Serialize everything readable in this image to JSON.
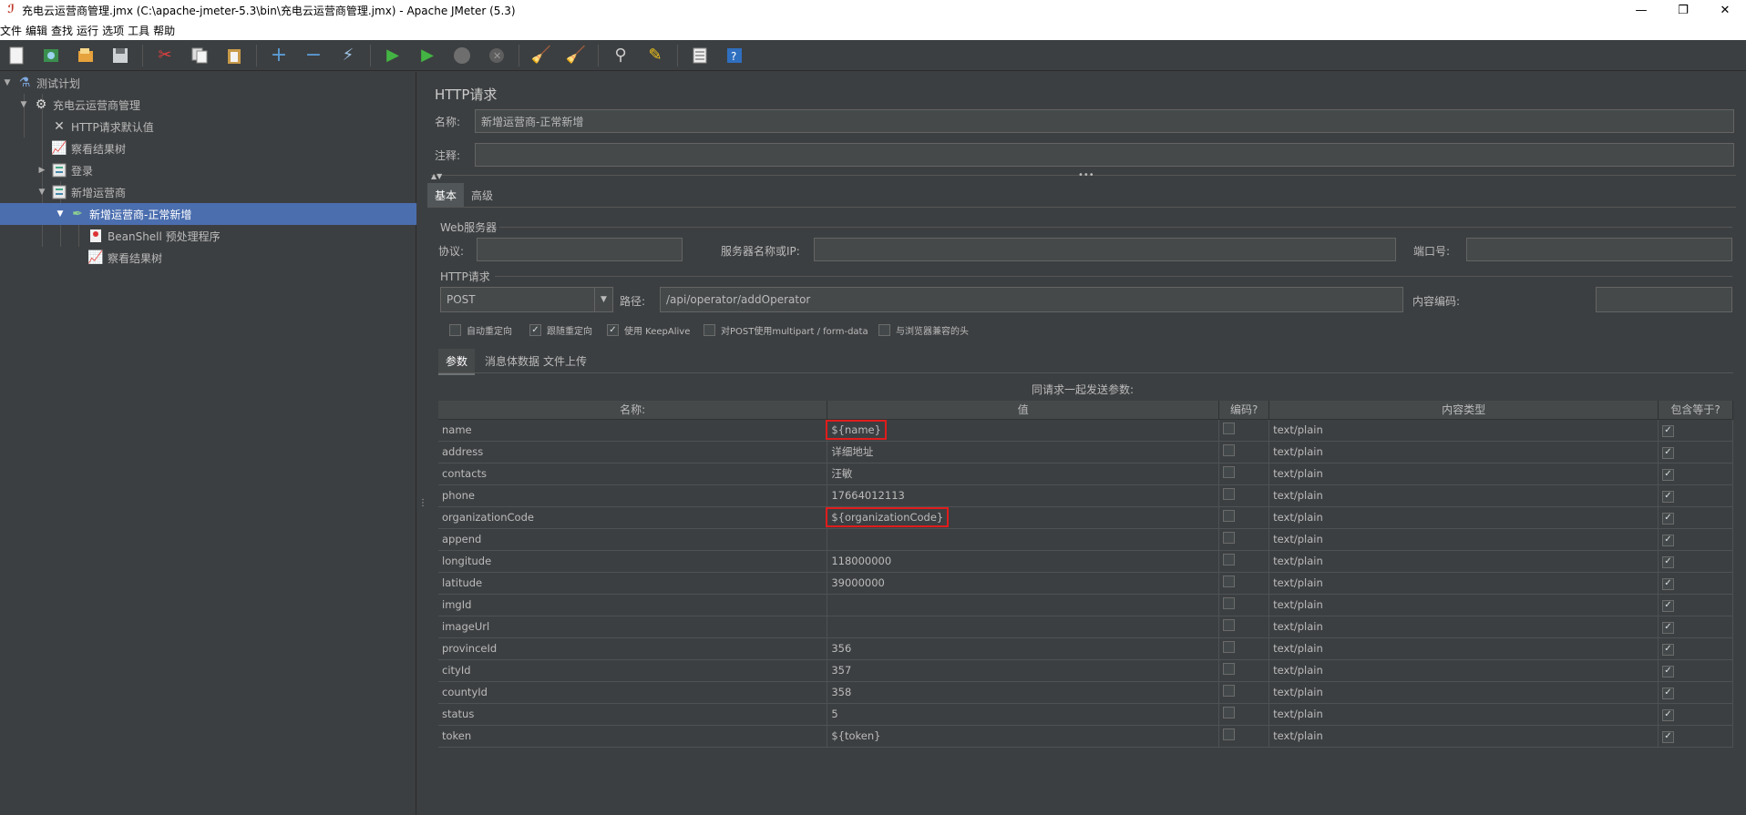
{
  "window": {
    "title": "充电云运营商管理.jmx (C:\\apache-jmeter-5.3\\bin\\充电云运营商管理.jmx) - Apache JMeter (5.3)",
    "minimize": "—",
    "maximize": "❐",
    "close": "✕"
  },
  "menu": [
    "文件",
    "编辑",
    "查找",
    "运行",
    "选项",
    "工具",
    "帮助"
  ],
  "tree": {
    "items": [
      {
        "label": "测试计划",
        "icon": "flask-icon"
      },
      {
        "label": "充电云运营商管理",
        "icon": "gear-icon"
      },
      {
        "label": "HTTP请求默认值",
        "icon": "wrench-icon"
      },
      {
        "label": "察看结果树",
        "icon": "chart-icon"
      },
      {
        "label": "登录",
        "icon": "controller-icon"
      },
      {
        "label": "新增运营商",
        "icon": "controller-icon"
      },
      {
        "label": "新增运营商-正常新增",
        "icon": "pipette-icon"
      },
      {
        "label": "BeanShell 预处理程序",
        "icon": "beanshell-icon"
      },
      {
        "label": "察看结果树",
        "icon": "chart-icon"
      }
    ]
  },
  "panel": {
    "heading": "HTTP请求",
    "name_label": "名称:",
    "name_value": "新增运营商-正常新增",
    "comment_label": "注释:",
    "comment_value": "",
    "tabs": [
      "基本",
      "高级"
    ],
    "web_server_title": "Web服务器",
    "protocol_label": "协议:",
    "protocol_value": "",
    "server_label": "服务器名称或IP:",
    "server_value": "",
    "port_label": "端口号:",
    "port_value": "",
    "http_request_title": "HTTP请求",
    "method": "POST",
    "path_label": "路径:",
    "path_value": "/api/operator/addOperator",
    "encoding_label": "内容编码:",
    "encoding_value": "",
    "options": [
      {
        "label": "自动重定向",
        "checked": false
      },
      {
        "label": "跟随重定向",
        "checked": true
      },
      {
        "label": "使用 KeepAlive",
        "checked": true
      },
      {
        "label": "对POST使用multipart / form-data",
        "checked": false
      },
      {
        "label": "与浏览器兼容的头",
        "checked": false
      }
    ],
    "subtabs": [
      "参数",
      "消息体数据",
      "文件上传"
    ],
    "params_caption": "同请求一起发送参数:",
    "columns": [
      "名称:",
      "值",
      "编码?",
      "内容类型",
      "包含等于?"
    ]
  },
  "params": [
    {
      "name": "name",
      "value": "${name}",
      "encode": false,
      "content_type": "text/plain",
      "include_equals": true,
      "highlight": true
    },
    {
      "name": "address",
      "value": "详细地址",
      "encode": false,
      "content_type": "text/plain",
      "include_equals": true,
      "highlight": false
    },
    {
      "name": "contacts",
      "value": "汪敏",
      "encode": false,
      "content_type": "text/plain",
      "include_equals": true,
      "highlight": false
    },
    {
      "name": "phone",
      "value": "17664012113",
      "encode": false,
      "content_type": "text/plain",
      "include_equals": true,
      "highlight": false
    },
    {
      "name": "organizationCode",
      "value": "${organizationCode}",
      "encode": false,
      "content_type": "text/plain",
      "include_equals": true,
      "highlight": true
    },
    {
      "name": "append",
      "value": "",
      "encode": false,
      "content_type": "text/plain",
      "include_equals": true,
      "highlight": false
    },
    {
      "name": "longitude",
      "value": "118000000",
      "encode": false,
      "content_type": "text/plain",
      "include_equals": true,
      "highlight": false
    },
    {
      "name": "latitude",
      "value": "39000000",
      "encode": false,
      "content_type": "text/plain",
      "include_equals": true,
      "highlight": false
    },
    {
      "name": "imgId",
      "value": "",
      "encode": false,
      "content_type": "text/plain",
      "include_equals": true,
      "highlight": false
    },
    {
      "name": "imageUrl",
      "value": "",
      "encode": false,
      "content_type": "text/plain",
      "include_equals": true,
      "highlight": false
    },
    {
      "name": "provinceId",
      "value": "356",
      "encode": false,
      "content_type": "text/plain",
      "include_equals": true,
      "highlight": false
    },
    {
      "name": "cityId",
      "value": "357",
      "encode": false,
      "content_type": "text/plain",
      "include_equals": true,
      "highlight": false
    },
    {
      "name": "countyId",
      "value": "358",
      "encode": false,
      "content_type": "text/plain",
      "include_equals": true,
      "highlight": false
    },
    {
      "name": "status",
      "value": "5",
      "encode": false,
      "content_type": "text/plain",
      "include_equals": true,
      "highlight": false
    },
    {
      "name": "token",
      "value": "${token}",
      "encode": false,
      "content_type": "text/plain",
      "include_equals": true,
      "highlight": false
    }
  ],
  "colors": {
    "accent_selection": "#4b6eaf",
    "highlight_border": "#e01c1c",
    "background": "#3c3f41"
  }
}
